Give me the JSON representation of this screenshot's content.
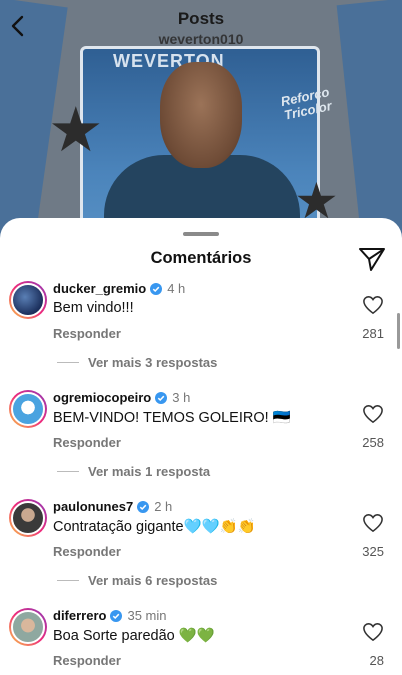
{
  "header": {
    "title": "Posts",
    "subtitle": "weverton010"
  },
  "post": {
    "card_name": "WEVERTON",
    "badge_text_line1": "Reforço",
    "badge_text_line2": "Tricolor"
  },
  "sheet": {
    "title": "Comentários"
  },
  "comments": [
    {
      "username": "ducker_gremio",
      "time": "4 h",
      "text": "Bem vindo!!!",
      "reply_label": "Responder",
      "likes": "281",
      "more": "Ver mais 3 respostas"
    },
    {
      "username": "ogremiocopeiro",
      "time": "3 h",
      "text": "BEM-VINDO! TEMOS GOLEIRO! 🇪🇪",
      "reply_label": "Responder",
      "likes": "258",
      "more": "Ver mais 1 resposta"
    },
    {
      "username": "paulonunes7",
      "time": "2 h",
      "text": "Contratação gigante🩵🩵👏👏",
      "reply_label": "Responder",
      "likes": "325",
      "more": "Ver mais 6 respostas"
    },
    {
      "username": "diferrero",
      "time": "35 min",
      "text": "Boa Sorte paredão 💚💚",
      "reply_label": "Responder",
      "likes": "28"
    }
  ],
  "colors": {
    "verified": "#3897f0",
    "secondary_text": "#777777"
  }
}
